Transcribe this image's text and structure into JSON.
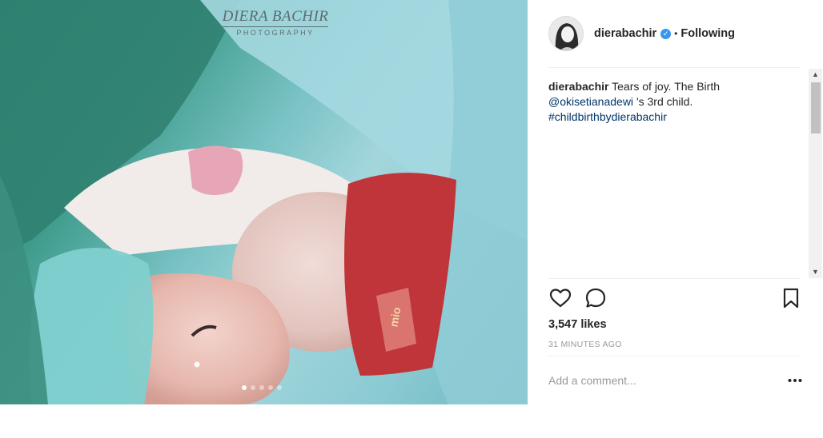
{
  "photo": {
    "watermark_name": "DIERA BACHIR",
    "watermark_sub": "PHOTOGRAPHY",
    "slide_count": 5,
    "active_slide": 1,
    "hat_tag": "mio"
  },
  "post": {
    "author": "dierabachir",
    "verified": true,
    "follow_status": "Following",
    "follow_separator": "•",
    "caption": {
      "username": "dierabachir",
      "text_before_mention": "Tears of joy. The Birth",
      "mention": "@okisetianadewi",
      "text_after_mention": "'s 3rd child.",
      "hashtag": "#childbirthbydierabachir"
    },
    "likes_text": "3,547 likes",
    "time_ago": "31 MINUTES AGO",
    "comment_placeholder": "Add a comment..."
  },
  "icons": {
    "like": "heart-icon",
    "comment": "comment-bubble-icon",
    "save": "bookmark-icon",
    "more": "ellipsis-icon",
    "verified": "verified-badge-icon"
  },
  "colors": {
    "link": "#003569",
    "verified": "#3897f0",
    "muted": "#999999",
    "text": "#262626"
  }
}
